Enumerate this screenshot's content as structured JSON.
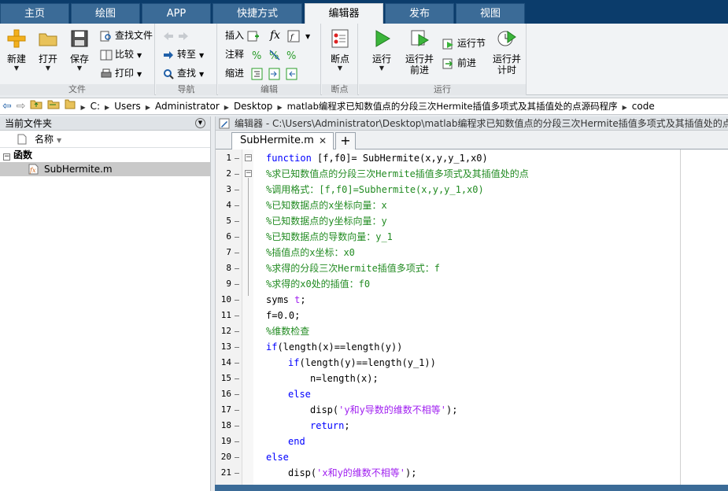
{
  "tabs": [
    {
      "label": "主页"
    },
    {
      "label": "绘图"
    },
    {
      "label": "APP"
    },
    {
      "label": "快捷方式"
    },
    {
      "label": "编辑器"
    },
    {
      "label": "发布"
    },
    {
      "label": "视图"
    }
  ],
  "ribbon": {
    "file": {
      "title": "文件",
      "new": "新建",
      "open": "打开",
      "save": "保存",
      "find_files": "查找文件",
      "compare": "比较",
      "print": "打印"
    },
    "nav": {
      "title": "导航",
      "goto": "转至",
      "find": "查找"
    },
    "edit": {
      "title": "编辑",
      "insert": "插入",
      "comment": "注释",
      "indent": "缩进",
      "fx": "fx"
    },
    "breakpoints": {
      "title": "断点",
      "label": "断点"
    },
    "run": {
      "title": "运行",
      "run": "运行",
      "run_advance_1": "运行并",
      "run_advance_2": "前进",
      "run_section": "运行节",
      "advance": "前进",
      "run_time_1": "运行并",
      "run_time_2": "计时"
    }
  },
  "address": {
    "crumbs": [
      "C:",
      "Users",
      "Administrator",
      "Desktop",
      "matlab编程求已知数值点的分段三次Hermite插值多项式及其插值处的点源码程序",
      "code"
    ]
  },
  "current_folder": {
    "title": "当前文件夹",
    "column": "名称",
    "group": "函数",
    "file": "SubHermite.m"
  },
  "editor": {
    "title": "编辑器 - C:\\Users\\Administrator\\Desktop\\matlab编程求已知数值点的分段三次Hermite插值多项式及其插值处的点",
    "tab": "SubHermite.m",
    "plus": "+"
  },
  "code": [
    {
      "n": "1",
      "indent": 0,
      "parts": [
        {
          "t": "function",
          "c": "kw"
        },
        {
          "t": " [f,f0]= SubHermite(x,y,y_1,x0)",
          "c": "plain"
        }
      ]
    },
    {
      "n": "2",
      "indent": 0,
      "parts": [
        {
          "t": "%求已知数值点的分段三次Hermite插值多项式及其插值处的点",
          "c": "cm"
        }
      ]
    },
    {
      "n": "3",
      "indent": 0,
      "parts": [
        {
          "t": "%调用格式：[f,f0]=Subhermite(x,y,y_1,x0)",
          "c": "cm"
        }
      ]
    },
    {
      "n": "4",
      "indent": 0,
      "parts": [
        {
          "t": "%已知数据点的x坐标向量：x",
          "c": "cm"
        }
      ]
    },
    {
      "n": "5",
      "indent": 0,
      "parts": [
        {
          "t": "%已知数据点的y坐标向量：y",
          "c": "cm"
        }
      ]
    },
    {
      "n": "6",
      "indent": 0,
      "parts": [
        {
          "t": "%已知数据点的导数向量：y_1",
          "c": "cm"
        }
      ]
    },
    {
      "n": "7",
      "indent": 0,
      "parts": [
        {
          "t": "%插值点的x坐标：x0",
          "c": "cm"
        }
      ]
    },
    {
      "n": "8",
      "indent": 0,
      "parts": [
        {
          "t": "%求得的分段三次Hermite插值多项式：f",
          "c": "cm"
        }
      ]
    },
    {
      "n": "9",
      "indent": 0,
      "parts": [
        {
          "t": "%求得的x0处的插值：f0",
          "c": "cm"
        }
      ]
    },
    {
      "n": "10",
      "indent": 0,
      "parts": [
        {
          "t": "syms ",
          "c": "plain"
        },
        {
          "t": "t",
          "c": "st"
        },
        {
          "t": ";",
          "c": "plain"
        }
      ]
    },
    {
      "n": "11",
      "indent": 0,
      "parts": [
        {
          "t": "f=0.0;",
          "c": "plain"
        }
      ]
    },
    {
      "n": "12",
      "indent": 0,
      "parts": [
        {
          "t": "%维数检查",
          "c": "cm"
        }
      ]
    },
    {
      "n": "13",
      "indent": 0,
      "parts": [
        {
          "t": "if",
          "c": "kw"
        },
        {
          "t": "(length(x)==length(y))",
          "c": "plain"
        }
      ]
    },
    {
      "n": "14",
      "indent": 1,
      "parts": [
        {
          "t": "if",
          "c": "kw"
        },
        {
          "t": "(length(y)==length(y_1))",
          "c": "plain"
        }
      ]
    },
    {
      "n": "15",
      "indent": 2,
      "parts": [
        {
          "t": "n=length(x);",
          "c": "plain"
        }
      ]
    },
    {
      "n": "16",
      "indent": 1,
      "parts": [
        {
          "t": "else",
          "c": "kw"
        }
      ]
    },
    {
      "n": "17",
      "indent": 2,
      "parts": [
        {
          "t": "disp(",
          "c": "plain"
        },
        {
          "t": "'y和y导数的维数不相等'",
          "c": "st"
        },
        {
          "t": ");",
          "c": "plain"
        }
      ]
    },
    {
      "n": "18",
      "indent": 2,
      "parts": [
        {
          "t": "return",
          "c": "kw"
        },
        {
          "t": ";",
          "c": "plain"
        }
      ]
    },
    {
      "n": "19",
      "indent": 1,
      "parts": [
        {
          "t": "end",
          "c": "kw"
        }
      ]
    },
    {
      "n": "20",
      "indent": 0,
      "parts": [
        {
          "t": "else",
          "c": "kw"
        }
      ]
    },
    {
      "n": "21",
      "indent": 1,
      "parts": [
        {
          "t": "disp(",
          "c": "plain"
        },
        {
          "t": "'x和y的维数不相等'",
          "c": "st"
        },
        {
          "t": ");",
          "c": "plain"
        }
      ]
    }
  ]
}
